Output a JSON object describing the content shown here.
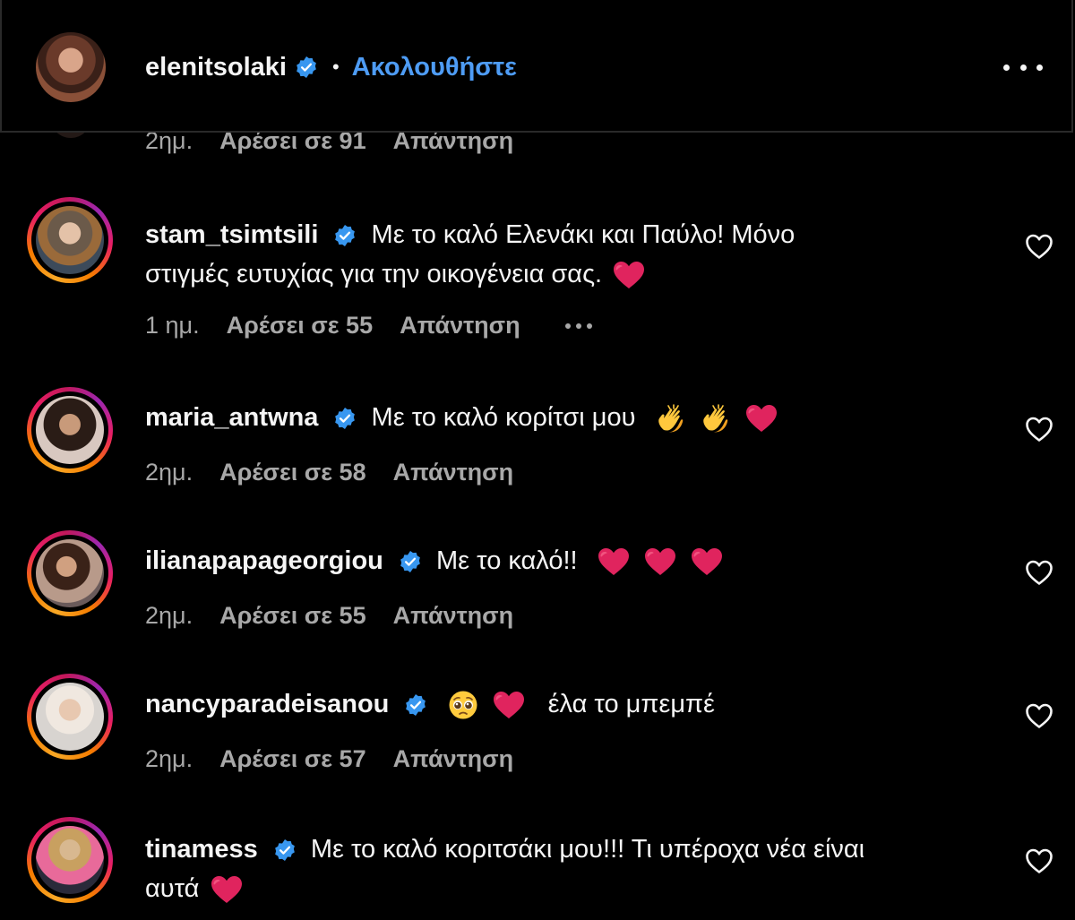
{
  "header": {
    "username": "elenitsolaki",
    "separator": "•",
    "follow_label": "Ακολουθήστε"
  },
  "partial_comment": {
    "time": "2ημ.",
    "likes": "Αρέσει σε 91",
    "reply": "Απάντηση"
  },
  "comments": [
    {
      "username": "stam_tsimtsili",
      "text_line1": "Με το καλό Ελενάκι και Παύλο! Μόνο",
      "text_line2": "στιγμές ευτυχίας για την οικογένεια σας.",
      "emojis": [
        "red-heart"
      ],
      "time": "1 ημ.",
      "likes": "Αρέσει σε 55",
      "reply": "Απάντηση"
    },
    {
      "username": "maria_antwna",
      "text": "Με το καλό κορίτσι μου",
      "emojis": [
        "clapping-hands",
        "clapping-hands",
        "red-heart"
      ],
      "time": "2ημ.",
      "likes": "Αρέσει σε 58",
      "reply": "Απάντηση"
    },
    {
      "username": "ilianapapageorgiou",
      "text": "Με το καλό!!",
      "emojis": [
        "red-heart",
        "red-heart",
        "red-heart"
      ],
      "time": "2ημ.",
      "likes": "Αρέσει σε 55",
      "reply": "Απάντηση"
    },
    {
      "username": "nancyparadeisanou",
      "text": "έλα το μπεμπέ",
      "emojis": [
        "pleading-face",
        "red-heart"
      ],
      "time": "2ημ.",
      "likes": "Αρέσει σε 57",
      "reply": "Απάντηση"
    },
    {
      "username": "tinamess",
      "text_line1": "Με το καλό κοριτσάκι μου!!! Τι υπέροχα νέα είναι",
      "text_line2": "αυτά",
      "emojis": [
        "red-heart"
      ]
    }
  ],
  "colors": {
    "background": "#000000",
    "text": "#f5f5f5",
    "secondary_text": "#a8a8a8",
    "link_blue": "#4e9cf5",
    "verified_blue": "#3897f0",
    "heart_red": "#e0245e"
  }
}
